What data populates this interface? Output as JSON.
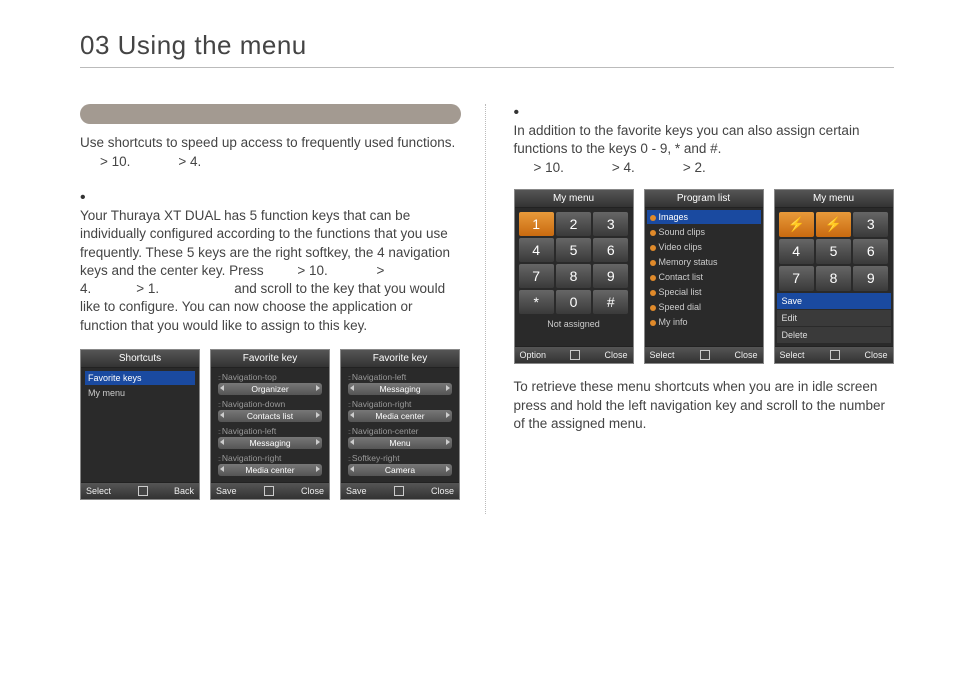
{
  "chapter_title": "03 Using the menu",
  "left": {
    "intro": "Use shortcuts to speed up access to frequently used functions.",
    "path1": "> 10.",
    "path2": "> 4.",
    "para1a": "Your Thuraya XT DUAL has 5 function keys that can be individually configured according to the functions that you use frequently. These 5 keys are the right softkey, the 4 navigation keys and the center key. Press",
    "para1b": "> 10.",
    "para1c": ">",
    "para1d": "4.",
    "para1e": "> 1.",
    "para1f": "and scroll to the key that you would like to configure. You can now choose the application or function that you would like to assign to this key.",
    "screens": {
      "s1": {
        "title": "Shortcuts",
        "items": [
          "Favorite keys",
          "My menu"
        ],
        "footer_left": "Select",
        "footer_right": "Back"
      },
      "s2": {
        "title": "Favorite key",
        "rows": [
          {
            "label": "Navigation-top",
            "value": "Organizer"
          },
          {
            "label": "Navigation-down",
            "value": "Contacts list"
          },
          {
            "label": "Navigation-left",
            "value": "Messaging"
          },
          {
            "label": "Navigation-right",
            "value": "Media center"
          }
        ],
        "footer_left": "Save",
        "footer_right": "Close"
      },
      "s3": {
        "title": "Favorite key",
        "rows": [
          {
            "label": "Navigation-left",
            "value": "Messaging"
          },
          {
            "label": "Navigation-right",
            "value": "Media center"
          },
          {
            "label": "Navigation-center",
            "value": "Menu"
          },
          {
            "label": "Softkey-right",
            "value": "Camera"
          }
        ],
        "footer_left": "Save",
        "footer_right": "Close"
      }
    }
  },
  "right": {
    "intro": "In addition to the favorite keys you can also assign certain functions to the keys 0 - 9, * and #.",
    "path1": "> 10.",
    "path2": "> 4.",
    "path3": "> 2.",
    "outro": "To retrieve these menu shortcuts when you are in idle screen press and hold the left navigation key and scroll to the number of the assigned menu.",
    "screens": {
      "s1": {
        "title": "My menu",
        "keys": [
          "1",
          "2",
          "3",
          "4",
          "5",
          "6",
          "7",
          "8",
          "9",
          "*",
          "0",
          "#"
        ],
        "not_assigned": "Not assigned",
        "footer_left": "Option",
        "footer_right": "Close"
      },
      "s2": {
        "title": "Program list",
        "items": [
          "Images",
          "Sound clips",
          "Video clips",
          "Memory status",
          "Contact list",
          "Special list",
          "Speed dial",
          "My info"
        ],
        "footer_left": "Select",
        "footer_right": "Close"
      },
      "s3": {
        "title": "My menu",
        "keys_row1": [
          "⚡",
          "⚡",
          "3"
        ],
        "keys_row2": [
          "4",
          "5",
          "6"
        ],
        "keys_row3": [
          "7",
          "8",
          "9"
        ],
        "menu": [
          "Save",
          "Edit",
          "Delete"
        ],
        "footer_left": "Select",
        "footer_right": "Close"
      }
    }
  }
}
